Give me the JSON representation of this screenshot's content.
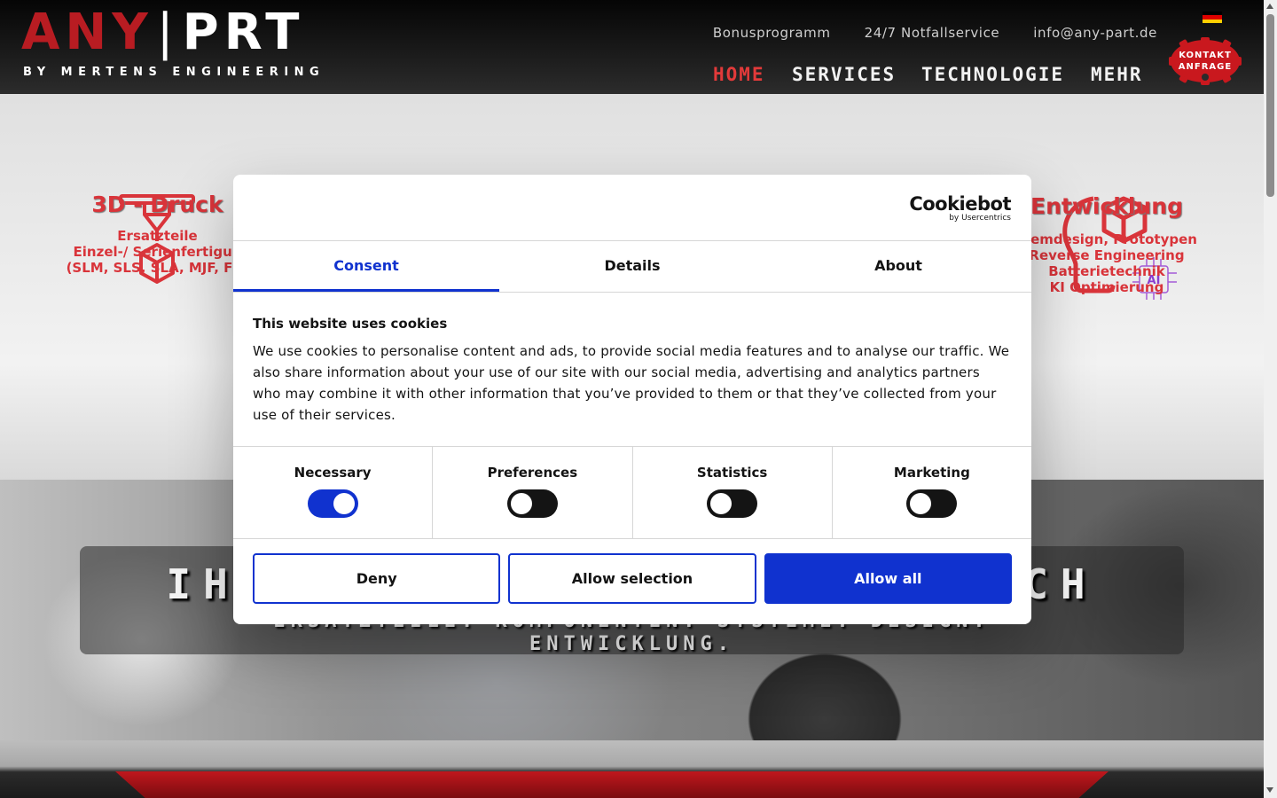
{
  "header": {
    "logo": {
      "any": "ANY",
      "prt": "PRT",
      "tagline": "BY MERTENS ENGINEERING"
    },
    "top_links": [
      "Bonusprogramm",
      "24/7 Notfallservice",
      "info@any-part.de"
    ],
    "language_flag": "german-flag-icon",
    "nav": [
      {
        "label": "HOME",
        "active": true
      },
      {
        "label": "SERVICES",
        "active": false
      },
      {
        "label": "TECHNOLOGIE",
        "active": false
      },
      {
        "label": "MEHR",
        "active": false
      }
    ],
    "contact_badge": {
      "line1": "KONTAKT",
      "line2": "ANFRAGE"
    }
  },
  "services": {
    "left": {
      "title": "3D - Druck",
      "lines": [
        "Ersatzteile",
        "Einzel-/ Serienfertigun",
        "(SLM, SLS, SLA, MJF, FDI"
      ]
    },
    "right": {
      "title": "Entwicklung",
      "lines": [
        "stemdesign, Prototypen",
        "Reverse Engineering",
        "Batterietechnik",
        "KI Optimierung"
      ],
      "badge": "AI"
    }
  },
  "hero": {
    "title_left": "IHR",
    "title_right": "UCH",
    "subtitle_line1": "ERSATZTEILE. KOMPONENTEN. SYSTEME. DESIGN.",
    "subtitle_line2": "ENTWICKLUNG."
  },
  "cookie_dialog": {
    "brand": "Cookiebot",
    "brand_sub": "by Usercentrics",
    "tabs": [
      {
        "label": "Consent",
        "active": true
      },
      {
        "label": "Details",
        "active": false
      },
      {
        "label": "About",
        "active": false
      }
    ],
    "title": "This website uses cookies",
    "text": "We use cookies to personalise content and ads, to provide social media features and to analyse our traffic. We also share information about your use of our site with our social media, advertising and analytics partners who may combine it with other information that you’ve provided to them or that they’ve collected from your use of their services.",
    "toggles": [
      {
        "label": "Necessary",
        "on": true
      },
      {
        "label": "Preferences",
        "on": false
      },
      {
        "label": "Statistics",
        "on": false
      },
      {
        "label": "Marketing",
        "on": false
      }
    ],
    "buttons": {
      "deny": "Deny",
      "allow_selection": "Allow selection",
      "allow_all": "Allow all"
    },
    "accent_color": "#1032cf"
  }
}
